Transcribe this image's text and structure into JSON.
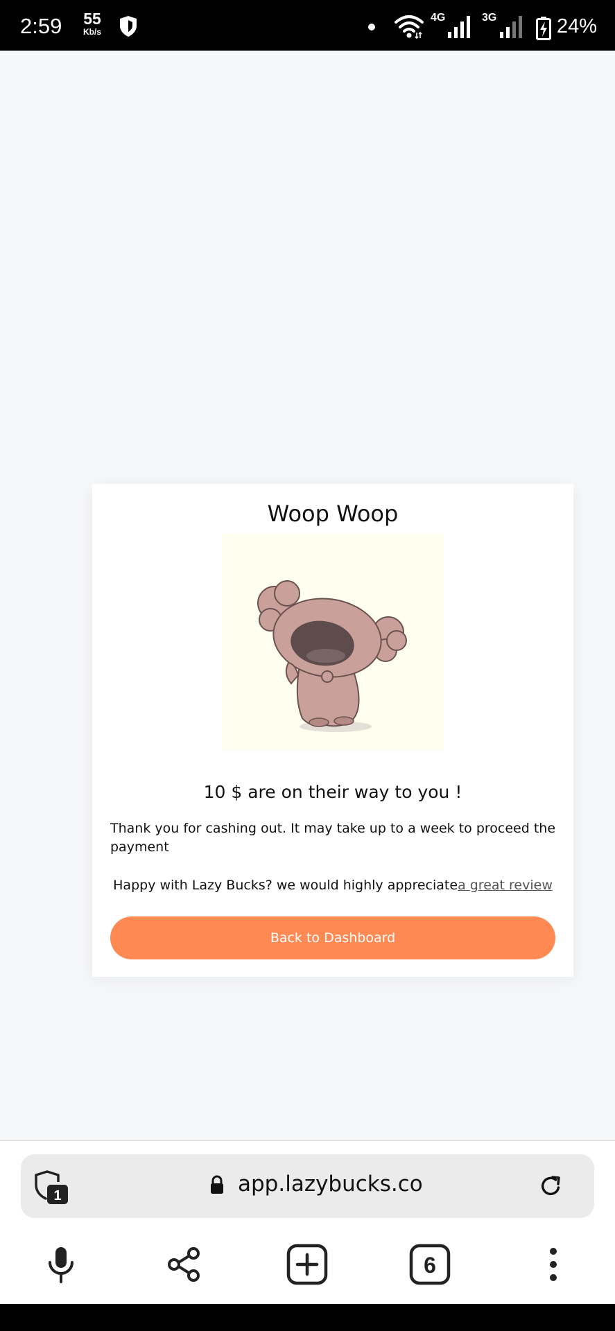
{
  "status_bar": {
    "time": "2:59",
    "speed_value": "55",
    "speed_unit": "Kb/s",
    "network_4g": "4G",
    "network_3g": "3G",
    "battery": "24%"
  },
  "card": {
    "title": "Woop Woop",
    "amount_message": "10 $ are on their way to you !",
    "thanks_message": "Thank you for cashing out. It may take up to a week to proceed the payment",
    "review_prompt": "Happy with Lazy Bucks? we would highly appreciate",
    "review_link": "a great review",
    "back_button": "Back to Dashboard",
    "button_color": "#ff8953"
  },
  "browser": {
    "url": "app.lazybucks.co",
    "tracker_count": "1",
    "tab_count": "6"
  },
  "icons": {
    "status": [
      "shield-icon",
      "wifi-icon",
      "signal-icon",
      "battery-charging-icon"
    ],
    "url_bar": [
      "tracker-shield-icon",
      "lock-icon",
      "reload-icon"
    ],
    "toolbar": [
      "microphone-icon",
      "share-icon",
      "new-tab-icon",
      "tabs-icon",
      "more-menu-icon"
    ]
  }
}
